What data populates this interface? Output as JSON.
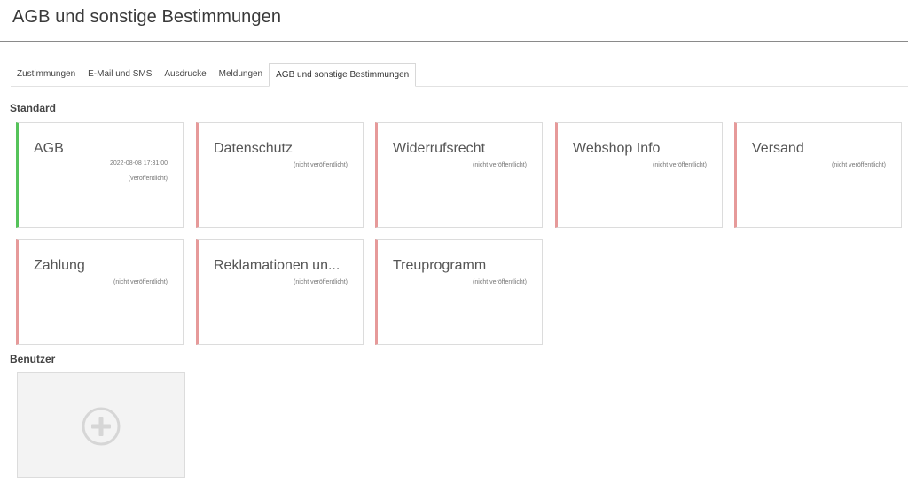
{
  "page": {
    "title": "AGB und sonstige Bestimmungen"
  },
  "tabs": [
    {
      "label": "Zustimmungen",
      "active": false
    },
    {
      "label": "E-Mail und SMS",
      "active": false
    },
    {
      "label": "Ausdrucke",
      "active": false
    },
    {
      "label": "Meldungen",
      "active": false
    },
    {
      "label": "AGB und sonstige Bestimmungen",
      "active": true
    }
  ],
  "standard": {
    "label": "Standard",
    "cards": [
      {
        "title": "AGB",
        "date": "2022-08-08 17:31:00",
        "status": "(veröffentlicht)"
      },
      {
        "title": "Datenschutz",
        "status": "(nicht veröffentlicht)"
      },
      {
        "title": "Widerrufsrecht",
        "status": "(nicht veröffentlicht)"
      },
      {
        "title": "Webshop Info",
        "status": "(nicht veröffentlicht)"
      },
      {
        "title": "Versand",
        "status": "(nicht veröffentlicht)"
      },
      {
        "title": "Zahlung",
        "status": "(nicht veröffentlicht)"
      },
      {
        "title": "Reklamationen un...",
        "status": "(nicht veröffentlicht)"
      },
      {
        "title": "Treuprogramm",
        "status": "(nicht veröffentlicht)"
      }
    ]
  },
  "benutzer": {
    "label": "Benutzer",
    "add_icon": "plus-circle-icon"
  },
  "colors": {
    "published_accent": "#55c35a",
    "unpublished_accent": "#e69a9a"
  }
}
